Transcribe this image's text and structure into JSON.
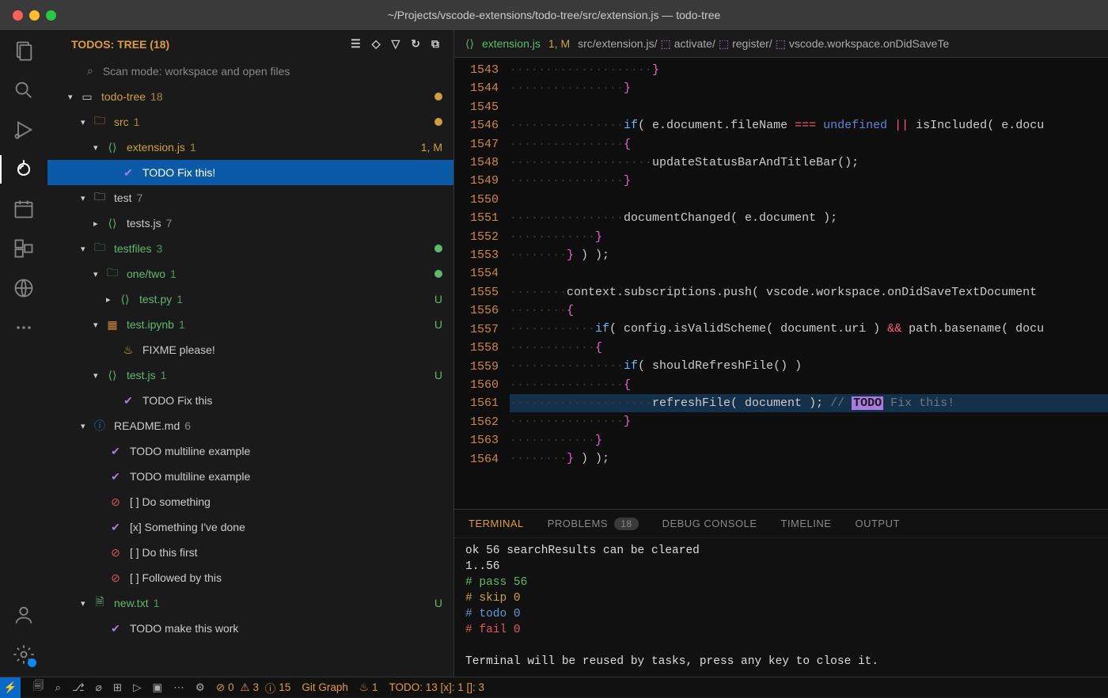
{
  "window": {
    "title": "~/Projects/vscode-extensions/todo-tree/src/extension.js — todo-tree"
  },
  "sidebar": {
    "title": "TODOS: TREE (18)",
    "scan_mode": "Scan mode: workspace and open files"
  },
  "tree": {
    "root": {
      "label": "todo-tree",
      "count": "18"
    },
    "src": {
      "label": "src",
      "count": "1"
    },
    "extjs": {
      "label": "extension.js",
      "count": "1",
      "badge": "1, M"
    },
    "todo_fix": "TODO Fix this!",
    "test": {
      "label": "test",
      "count": "7"
    },
    "testsjs": {
      "label": "tests.js",
      "count": "7"
    },
    "testfiles": {
      "label": "testfiles",
      "count": "3"
    },
    "onetwo": {
      "label": "one/two",
      "count": "1"
    },
    "testpy": {
      "label": "test.py",
      "count": "1",
      "badge": "U"
    },
    "testipynb": {
      "label": "test.ipynb",
      "count": "1",
      "badge": "U"
    },
    "fixme": "FIXME please!",
    "testjs": {
      "label": "test.js",
      "count": "1",
      "badge": "U"
    },
    "todo_fix2": "TODO Fix this",
    "readme": {
      "label": "README.md",
      "count": "6"
    },
    "ml1": "TODO multiline example",
    "ml2": "TODO multiline example",
    "ds": "[ ] Do something",
    "sid": "[x] Something I've done",
    "dtf": "[ ] Do this first",
    "fbt": "[ ] Followed by this",
    "newtxt": {
      "label": "new.txt",
      "count": "1",
      "badge": "U"
    },
    "mtw": "TODO make this work"
  },
  "editor": {
    "filename": "extension.js",
    "tab_meta": "1, M",
    "crumb1": "src/extension.js/",
    "crumb2": "activate/",
    "crumb3": "register/",
    "crumb4": "vscode.workspace.onDidSaveTe",
    "line_start": 1543,
    "line_end": 1564
  },
  "code": {
    "l1543": "                    }",
    "l1544": "                }",
    "l1545": "",
    "l1546a": "                if( e.document.fileName ",
    "l1546b": "=== ",
    "l1546c": "undefined",
    "l1546d": " || isIncluded( e.docu",
    "l1547": "                {",
    "l1548": "                    updateStatusBarAndTitleBar();",
    "l1549": "                }",
    "l1550": "",
    "l1551": "                documentChanged( e.document );",
    "l1552": "            }",
    "l1553": "        } ) );",
    "l1554": "",
    "l1555": "        context.subscriptions.push( vscode.workspace.onDidSaveTextDocument",
    "l1556": "        {",
    "l1557": "            if( config.isValidScheme( document.uri ) && path.basename( docu",
    "l1558": "            {",
    "l1559": "                if( shouldRefreshFile() )",
    "l1560": "                {",
    "l1561a": "                    refreshFile( document ); ",
    "l1561b": "// ",
    "l1561c": "TODO",
    "l1561d": " Fix this!",
    "l1562": "                }",
    "l1563": "            }",
    "l1564": "        } ) );"
  },
  "panel": {
    "tabs": {
      "terminal": "TERMINAL",
      "problems": "PROBLEMS",
      "problems_badge": "18",
      "debug": "DEBUG CONSOLE",
      "timeline": "TIMELINE",
      "output": "OUTPUT"
    },
    "terminal": {
      "l1": "ok 56 searchResults can be cleared",
      "l2": "1..56",
      "l3": "# pass 56",
      "l4": "# skip 0",
      "l5": "# todo 0",
      "l6": "# fail 0",
      "l7": "",
      "l8": "Terminal will be reused by tasks, press any key to close it."
    }
  },
  "statusbar": {
    "errors": "0",
    "warnings": "3",
    "info": "15",
    "gitgraph": "Git Graph",
    "flame": "1",
    "todos": "TODO: 13  [x]: 1  []: 3"
  }
}
